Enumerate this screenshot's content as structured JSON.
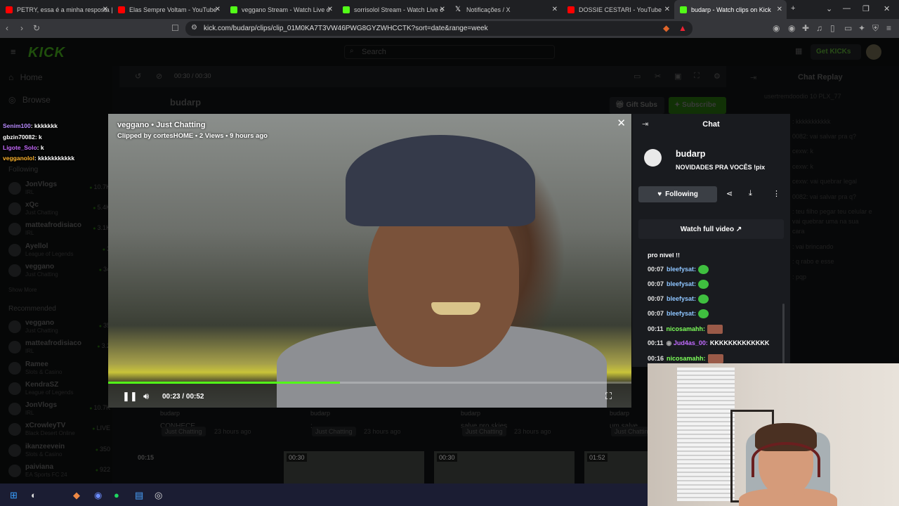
{
  "browser": {
    "tabs": [
      {
        "label": "PETRY, essa é a minha resposta | TR",
        "color": "#ff0000"
      },
      {
        "label": "Elas Sempre Voltam - YouTube",
        "color": "#ff0000"
      },
      {
        "label": "veggano Stream - Watch Live o",
        "color": "#53fc18"
      },
      {
        "label": "sorrisolol Stream - Watch Live o",
        "color": "#53fc18"
      },
      {
        "label": "Notificações / X",
        "color": "#ffffff"
      },
      {
        "label": "DOSSIE CESTARI - YouTube",
        "color": "#ff0000"
      },
      {
        "label": "budarp - Watch clips on Kick",
        "color": "#53fc18"
      }
    ],
    "new_tab": "+",
    "url": "kick.com/budarp/clips/clip_01M0KA7T3VW46PWG8GYZWHCCTK?sort=date&range=week"
  },
  "kick": {
    "logo": "KICK",
    "search_placeholder": "Search",
    "get_kicks": "Get KICKs",
    "nav": {
      "home": "Home",
      "browse": "Browse",
      "following_heading": "Following",
      "show_more": "Show More",
      "recommended_heading": "Recommended"
    },
    "following": [
      {
        "name": "JonVlogs",
        "sub": "IRL",
        "count": "10.7K"
      },
      {
        "name": "xQc",
        "sub": "Just Chatting",
        "count": "5.4K"
      },
      {
        "name": "matteafrodisiaco",
        "sub": "IRL",
        "count": "3.1K"
      },
      {
        "name": "Ayellol",
        "sub": "League of Legends",
        "count": "3"
      },
      {
        "name": "veggano",
        "sub": "Just Chatting",
        "count": "34"
      }
    ],
    "recommended": [
      {
        "name": "veggano",
        "sub": "Just Chatting",
        "count": "35"
      },
      {
        "name": "matteafrodisiaco",
        "sub": "IRL",
        "count": "3.2"
      },
      {
        "name": "Ramee",
        "sub": "Slots & Casino",
        "count": ""
      },
      {
        "name": "KendraSZ",
        "sub": "League of Legends",
        "count": ""
      },
      {
        "name": "JonVlogs",
        "sub": "IRL",
        "count": "10.7K"
      },
      {
        "name": "xCrowleyTV",
        "sub": "Black Desert Online",
        "count": "LIVE"
      },
      {
        "name": "ikanzeevein",
        "sub": "Slots & Casino",
        "count": "350"
      },
      {
        "name": "paiviana",
        "sub": "EA Sports FC 24",
        "count": "922"
      }
    ],
    "bg_player_time": "00:30 / 00:30",
    "bg_channel": "budarp",
    "gift_subs": "Gift Subs",
    "subscribe": "Subscribe",
    "chat_replay": "Chat Replay",
    "bg_chat": [
      {
        "text": "usertremdoodio  10  PLX_77"
      },
      {
        "text": ": kkkkkkkkkkk"
      },
      {
        "text": "0082: vai salvar pra q?"
      },
      {
        "text": "cexw: k"
      },
      {
        "text": "cexw: k"
      },
      {
        "text": "cexw: vai quebrar legal"
      },
      {
        "text": "0082: vai salvar pra q?"
      },
      {
        "text": ": teu filho pegar teu celular e"
      },
      {
        "text": "vai quebrar uma na sua"
      },
      {
        "text": "cara"
      },
      {
        "text": ": vai brincando"
      },
      {
        "text": ": q rabo e esse"
      },
      {
        "text": ": pqp"
      }
    ],
    "clip_cards": [
      {
        "channel": "budarp",
        "title": "CONHECE",
        "cat": "Just Chatting",
        "time": "23 hours ago"
      },
      {
        "channel": "budarp",
        "title": ":",
        "cat": "Just Chatting",
        "time": "23 hours ago"
      },
      {
        "channel": "budarp",
        "title": "salve pro skies",
        "cat": "Just Chatting",
        "time": "23 hours ago"
      },
      {
        "channel": "budarp",
        "title": "um salve",
        "cat": "Just Chatting",
        "time": ""
      }
    ],
    "thumb_durations": [
      "00:15",
      "00:30",
      "00:30",
      "01:52"
    ]
  },
  "overlay_chat": [
    {
      "user": "Senim100",
      "msg": ": kkkkkkk",
      "color": "#b98cff"
    },
    {
      "user": "gbzin70082",
      "msg": ": k",
      "color": "#ffffff"
    },
    {
      "user": "Ligote_Solo",
      "msg": ": k",
      "color": "#c86bff"
    },
    {
      "user": "vegganolol",
      "msg": ": kkkkkkkkkkk",
      "color": "#ffb52e"
    }
  ],
  "clip_modal": {
    "title": "veggano • Just Chatting",
    "subtitle": "Clipped by cortesHOME • 2 Views • 9 hours ago",
    "time": "00:23 / 00:52",
    "progress": 0.4423,
    "panel": {
      "title": "Chat",
      "channel": "budarp",
      "stream_title": "NOVIDADES PRA VOCÊS !pix",
      "following_label": "Following",
      "watch_full": "Watch full video ↗"
    },
    "chat": [
      {
        "ts": "",
        "user": "",
        "msg": "pro nivel !!",
        "user_color": "#ffffff",
        "emote": ""
      },
      {
        "ts": "00:07",
        "user": "bleefysat:",
        "msg": "",
        "user_color": "#8ec5ff",
        "emote": "#3fbf3f"
      },
      {
        "ts": "00:07",
        "user": "bleefysat:",
        "msg": "",
        "user_color": "#8ec5ff",
        "emote": "#3fbf3f"
      },
      {
        "ts": "00:07",
        "user": "bleefysat:",
        "msg": "",
        "user_color": "#8ec5ff",
        "emote": "#3fbf3f"
      },
      {
        "ts": "00:07",
        "user": "bleefysat:",
        "msg": "",
        "user_color": "#8ec5ff",
        "emote": "#3fbf3f"
      },
      {
        "ts": "00:11",
        "user": "nicosamahh:",
        "msg": "",
        "user_color": "#7dff5a",
        "emote": "#9a5a48"
      },
      {
        "ts": "00:11",
        "user": "Jud4as_00:",
        "msg": "KKKKKKKKKKKKK",
        "user_color": "#c16bff",
        "emote": ""
      },
      {
        "ts": "00:16",
        "user": "nicosamahh:",
        "msg": "",
        "user_color": "#7dff5a",
        "emote": "#9a5a48"
      }
    ]
  }
}
